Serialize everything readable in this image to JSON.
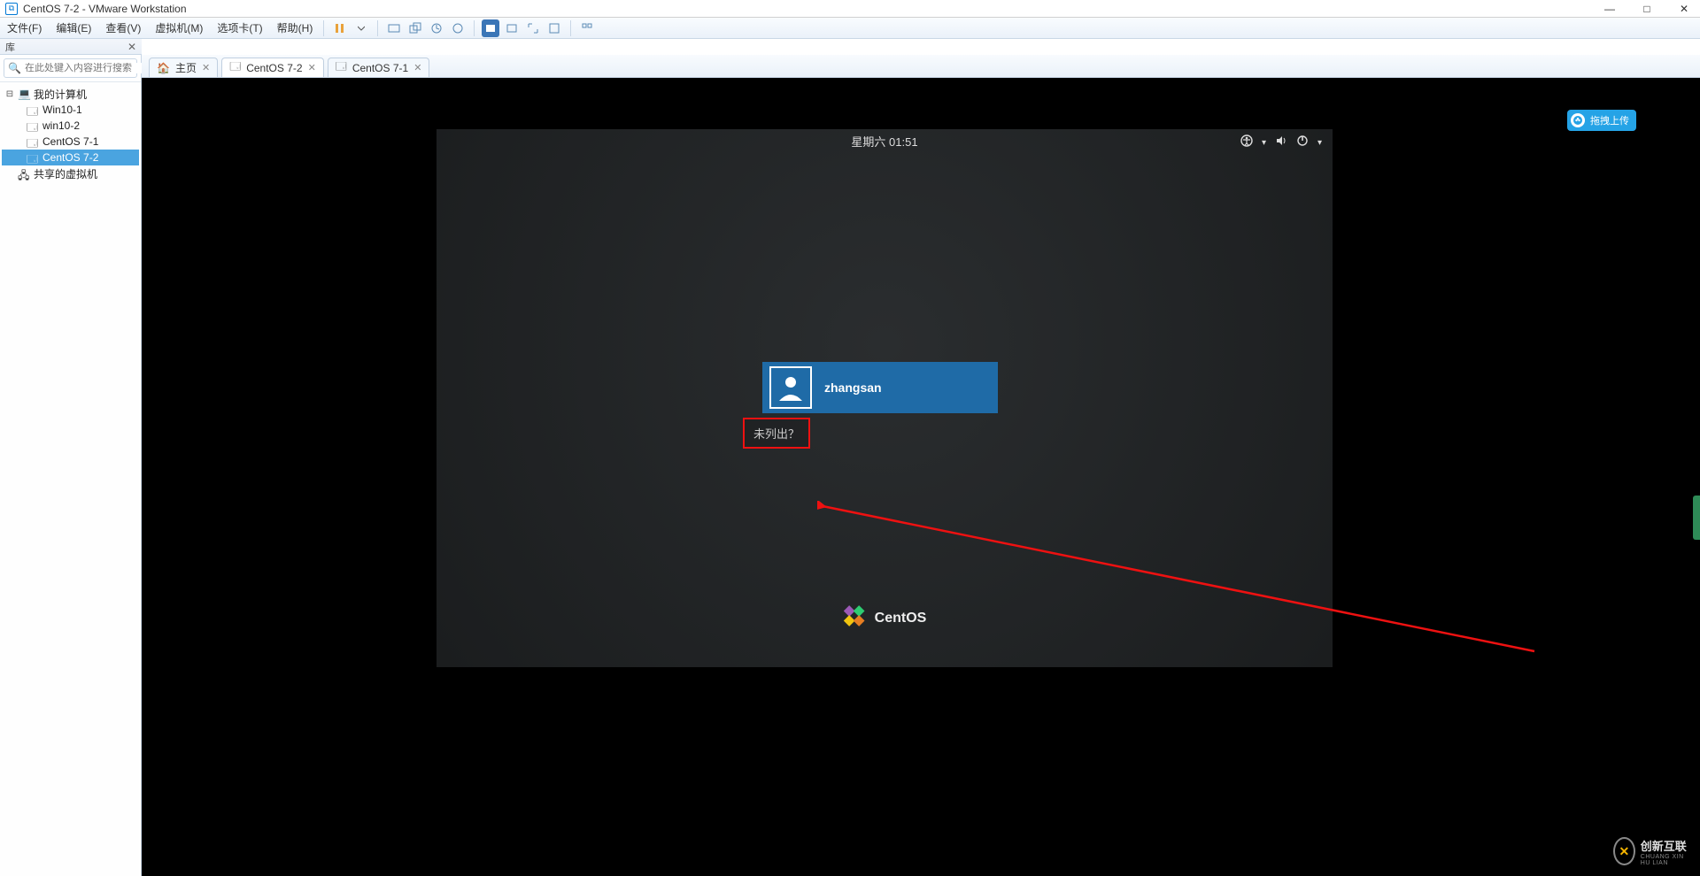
{
  "window": {
    "title": "CentOS 7-2 - VMware Workstation",
    "controls": {
      "min": "—",
      "max": "□",
      "close": "✕"
    }
  },
  "menubar": {
    "items": [
      "文件(F)",
      "编辑(E)",
      "查看(V)",
      "虚拟机(M)",
      "选项卡(T)",
      "帮助(H)"
    ]
  },
  "library": {
    "header": "库",
    "search_placeholder": "在此处键入内容进行搜索",
    "root": "我的计算机",
    "nodes": [
      "Win10-1",
      "win10-2",
      "CentOS 7-1",
      "CentOS 7-2"
    ],
    "shared": "共享的虚拟机",
    "selected": "CentOS 7-2"
  },
  "tabs": [
    {
      "label": "主页",
      "kind": "home"
    },
    {
      "label": "CentOS 7-2",
      "kind": "vm",
      "active": true
    },
    {
      "label": "CentOS 7-1",
      "kind": "vm"
    }
  ],
  "guest": {
    "datetime": "星期六 01:51",
    "user": "zhangsan",
    "not_listed": "未列出？",
    "brand": "CentOS"
  },
  "upload_badge": "拖拽上传",
  "cx_brand": {
    "title": "创新互联",
    "sub": "CHUANG XIN HU LIAN"
  }
}
